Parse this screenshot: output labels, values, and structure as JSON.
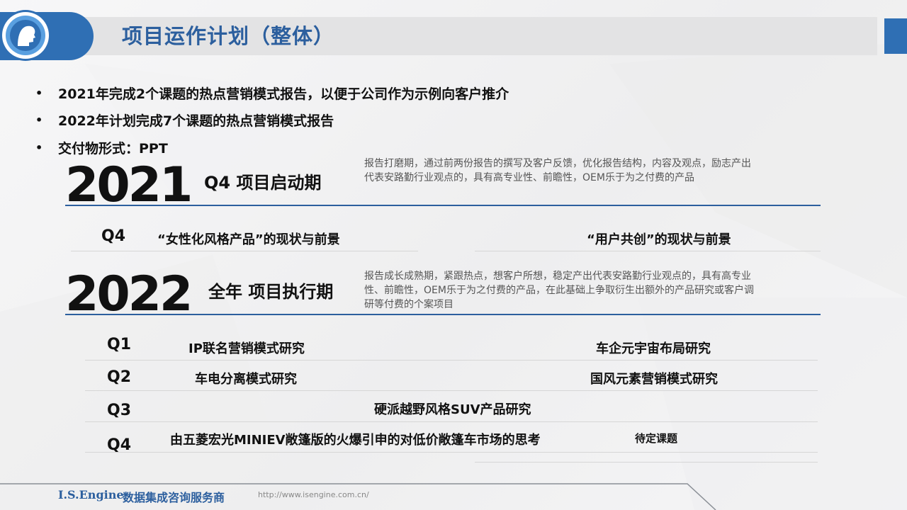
{
  "header": {
    "title": "项目运作计划（整体）"
  },
  "bullets": [
    "2021年完成2个课题的热点营销模式报告，以便于公司作为示例向客户推介",
    "2022年计划完成7个课题的热点营销模式报告",
    "交付物形式：PPT"
  ],
  "section2021": {
    "year": "2021",
    "phase": "Q4 项目启动期",
    "desc_line1": "报告打磨期，通过前两份报告的撰写及客户反馈，优化报告结构，内容及观点，励志产出",
    "desc_line2": "代表安路勤行业观点的，具有高专业性、前瞻性，OEM乐于为之付费的产品",
    "rows": [
      {
        "q": "Q4",
        "left": "“女性化风格产品”的现状与前景",
        "right": "“用户共创”的现状与前景"
      }
    ]
  },
  "section2022": {
    "year": "2022",
    "phase": "全年 项目执行期",
    "desc_line1": "报告成长成熟期，紧跟热点，想客户所想，稳定产出代表安路勤行业观点的，具有高专业",
    "desc_line2": "性、前瞻性，OEM乐于为之付费的产品，在此基础上争取衍生出额外的产品研究或客户调",
    "desc_line3": "研等付费的个案项目",
    "rows": [
      {
        "q": "Q1",
        "left": "IP联名营销模式研究",
        "right": "车企元宇宙布局研究"
      },
      {
        "q": "Q2",
        "left": "车电分离模式研究",
        "right": "国风元素营销模式研究"
      },
      {
        "q": "Q3",
        "center": "硬派越野风格SUV产品研究"
      },
      {
        "q": "Q4",
        "left": "由五菱宏光MINIEV敞篷版的火爆引申的对低价敞篷车市场的思考",
        "right": "待定课题"
      }
    ]
  },
  "footer": {
    "name": "I.S.Engine",
    "subtitle": "数据集成咨询服务商",
    "url": "http://www.isengine.com.cn/"
  },
  "colors": {
    "accent": "#2f6fb4",
    "title": "#2c5f9e"
  },
  "icons": {
    "logo": "head-profile-logo-icon"
  }
}
